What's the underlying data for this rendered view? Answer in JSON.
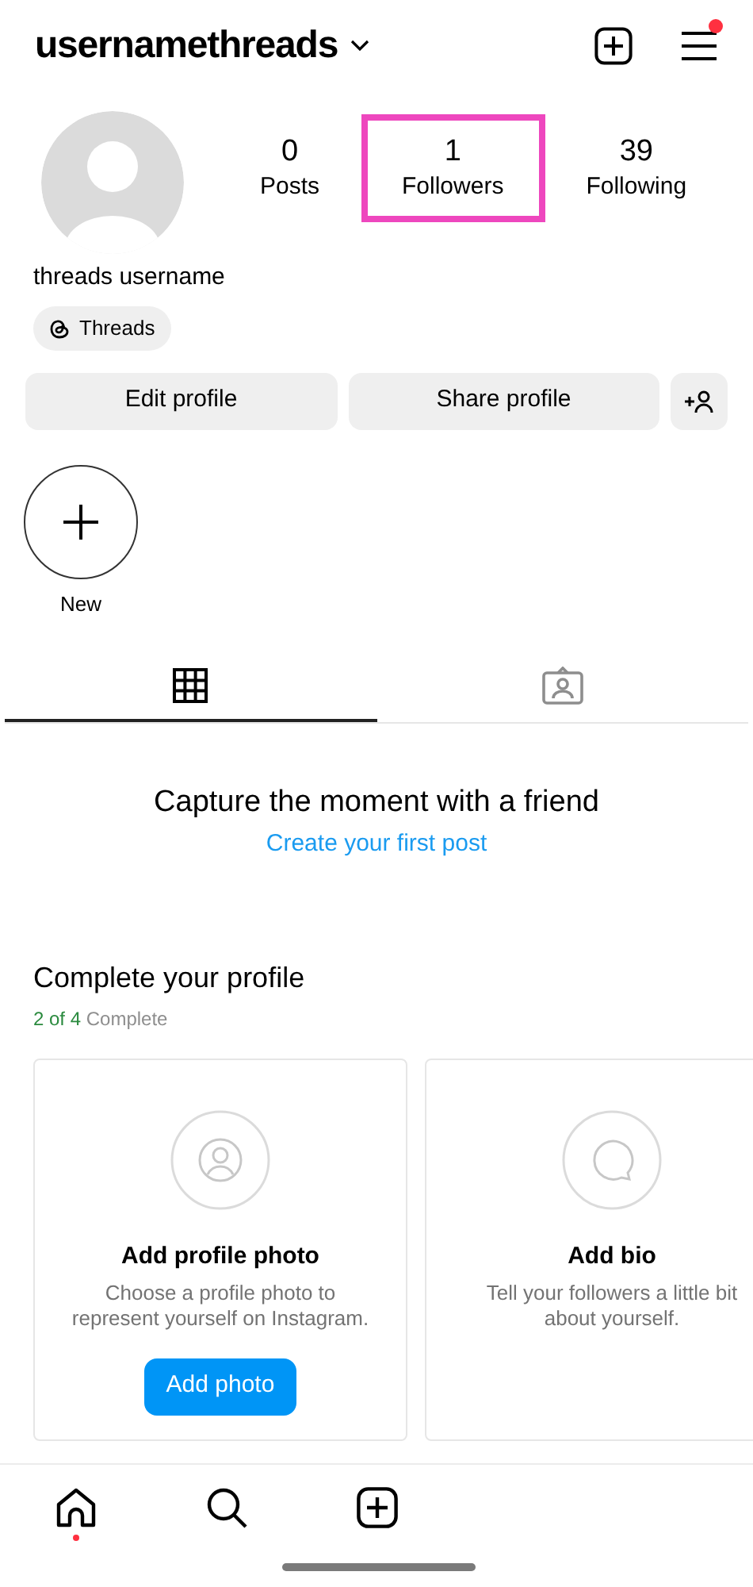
{
  "header": {
    "username": "usernamethreads",
    "menu_badge": true
  },
  "profile": {
    "name": "threads username",
    "threads_badge": "Threads"
  },
  "stats": [
    {
      "value": "0",
      "label": "Posts",
      "highlighted": false
    },
    {
      "value": "1",
      "label": "Followers",
      "highlighted": true
    },
    {
      "value": "39",
      "label": "Following",
      "highlighted": false
    }
  ],
  "actions": [
    "Edit profile",
    "Share profile"
  ],
  "highlights": [
    {
      "label": "New"
    }
  ],
  "tabs": [
    {
      "kind": "grid",
      "selected": true
    },
    {
      "kind": "tagged",
      "selected": false
    }
  ],
  "empty_state": {
    "title": "Capture the moment with a friend",
    "link": "Create your first post"
  },
  "complete_profile": {
    "title": "Complete your profile",
    "progress": "2 of 4",
    "progress_label": "Complete",
    "cards": [
      {
        "kind": "photo",
        "title": "Add profile photo",
        "description": "Choose a profile photo to represent yourself on Instagram.",
        "button": "Add photo"
      },
      {
        "kind": "bio",
        "title": "Add bio",
        "description": "Tell your followers a little bit about yourself."
      }
    ]
  },
  "bottom_nav": [
    {
      "kind": "home",
      "badge": true
    },
    {
      "kind": "search",
      "badge": false
    },
    {
      "kind": "create",
      "badge": false
    }
  ]
}
